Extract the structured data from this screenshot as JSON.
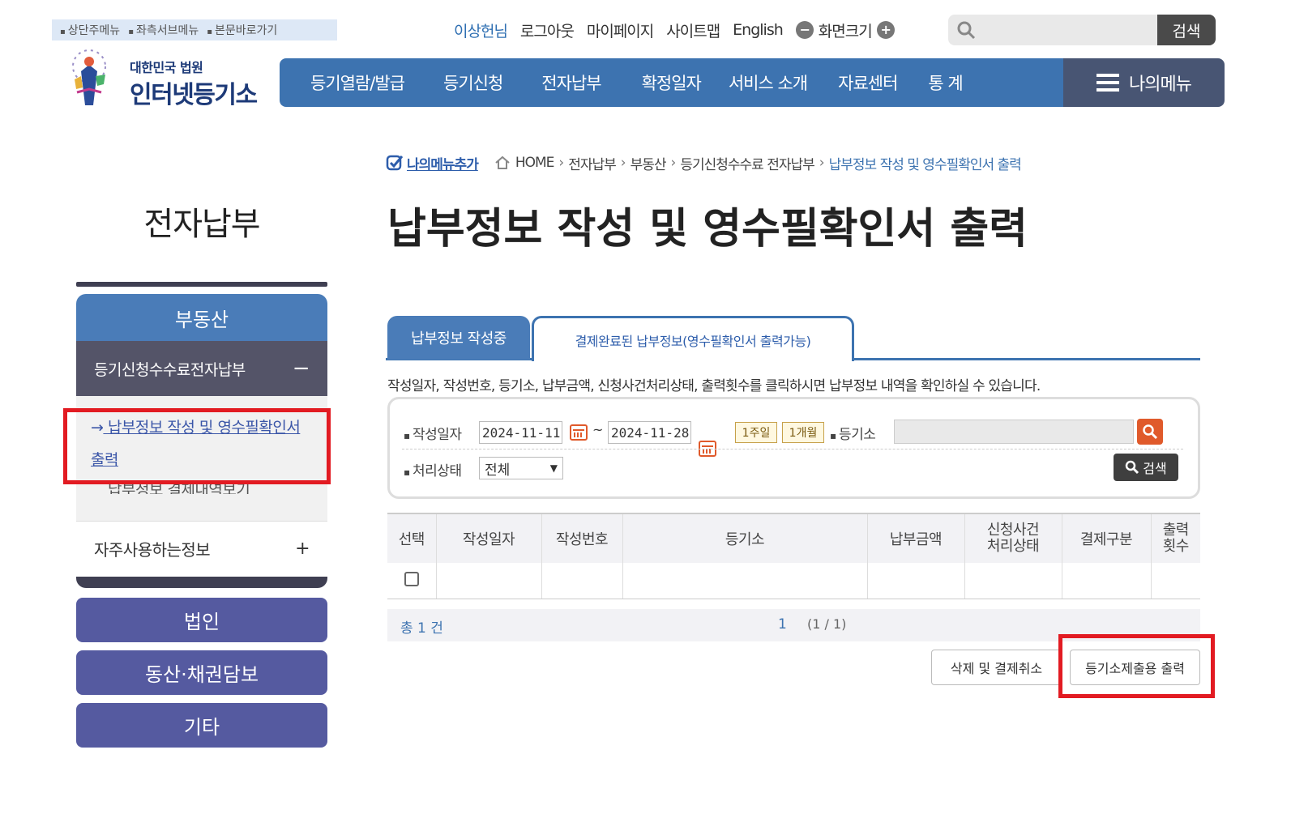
{
  "skip_links": [
    "상단주메뉴",
    "좌측서브메뉴",
    "본문바로가기"
  ],
  "logo": {
    "line1": "대한민국 법원",
    "line2": "인터넷등기소"
  },
  "util": {
    "user": "이상헌님",
    "logout": "로그아웃",
    "mypage": "마이페이지",
    "sitemap": "사이트맵",
    "english": "English",
    "zoom_label": "화면크기",
    "search_button": "검색"
  },
  "gnb": [
    "등기열람/발급",
    "등기신청",
    "전자납부",
    "확정일자",
    "서비스 소개",
    "자료센터",
    "통 계"
  ],
  "my_menu": "나의메뉴",
  "sidebar": {
    "title": "전자납부",
    "section": "부동산",
    "sub_open": "등기신청수수료전자납부",
    "sub_open_sign": "−",
    "active_link": "납부정보 작성 및 영수필확인서 출력",
    "next_link": "납부정보 결제내역보기",
    "often": "자주사용하는정보",
    "often_sign": "+",
    "buttons": [
      "법인",
      "동산·채권담보",
      "기타"
    ]
  },
  "breadcrumb": {
    "add": "나의메뉴추가",
    "items": [
      "HOME",
      "전자납부",
      "부동산",
      "등기신청수수료 전자납부",
      "납부정보 작성 및 영수필확인서 출력"
    ]
  },
  "page_title": "납부정보 작성 및 영수필확인서 출력",
  "tabs": [
    "납부정보 작성중",
    "결제완료된 납부정보(영수필확인서 출력가능)"
  ],
  "description": "작성일자, 작성번호, 등기소, 납부금액, 신청사건처리상태, 출력횟수를 클릭하시면 납부정보 내역을 확인하실 수 있습니다.",
  "filter": {
    "date_label": "작성일자",
    "date_from": "2024-11-11",
    "date_sep": "~",
    "date_to": "2024-11-28",
    "week_btn": "1주일",
    "month_btn": "1개월",
    "registry_label": "등기소",
    "registry_value": "",
    "status_label": "처리상태",
    "status_value": "전체",
    "search_btn": "검색"
  },
  "table": {
    "headers": [
      "선택",
      "작성일자",
      "작성번호",
      "등기소",
      "납부금액",
      "신청사건\n처리상태",
      "결제구분",
      "출력\n횟수"
    ],
    "rows": [
      [
        "",
        "",
        "",
        "",
        "",
        "",
        "",
        ""
      ]
    ]
  },
  "pager": {
    "total": "총 1 건",
    "page": "1",
    "count": "(1 / 1)"
  },
  "actions": {
    "delete_cancel": "삭제 및 결제취소",
    "print": "등기소제출용 출력"
  },
  "colors": {
    "primary": "#3d73b0",
    "dark": "#485573",
    "side_btn": "#555aa0",
    "highlight": "#e21b22"
  }
}
